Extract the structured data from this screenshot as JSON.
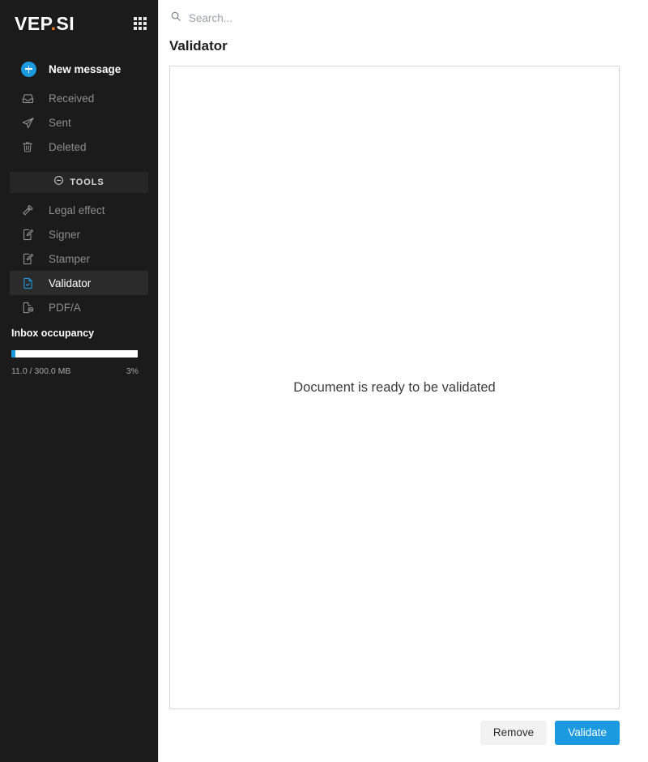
{
  "sidebar": {
    "brand": {
      "part1": "VEP",
      "dot": ".",
      "part2": "SI"
    },
    "apps_icon": "apps-grid-icon",
    "primary_action": {
      "label": "New message",
      "icon": "plus-circle-icon"
    },
    "nav_items": [
      {
        "label": "Received",
        "icon": "inbox-icon"
      },
      {
        "label": "Sent",
        "icon": "paper-plane-icon"
      },
      {
        "label": "Deleted",
        "icon": "trash-icon"
      }
    ],
    "tools_section": {
      "label": "TOOLS",
      "collapse_icon": "minus-circle-icon",
      "items": [
        {
          "label": "Legal effect",
          "icon": "gavel-icon",
          "active": false
        },
        {
          "label": "Signer",
          "icon": "document-pen-icon",
          "active": false
        },
        {
          "label": "Stamper",
          "icon": "document-pen-icon",
          "active": false
        },
        {
          "label": "Validator",
          "icon": "document-check-icon",
          "active": true
        },
        {
          "label": "PDF/A",
          "icon": "pdf-icon",
          "active": false
        }
      ]
    },
    "occupancy": {
      "title": "Inbox occupancy",
      "usage_text": "11.0 / 300.0 MB",
      "percent_text": "3%",
      "percent_value": 3
    }
  },
  "main": {
    "search": {
      "placeholder": "Search...",
      "value": "",
      "icon": "search-icon"
    },
    "page_title": "Validator",
    "document_panel": {
      "status_text": "Document is ready to be validated"
    },
    "buttons": {
      "remove": "Remove",
      "validate": "Validate"
    }
  },
  "colors": {
    "sidebar_bg": "#1b1b1b",
    "accent_blue": "#1b9ae0",
    "brand_dot_orange": "#f07c21",
    "active_row_bg": "#2b2b2b",
    "panel_border": "#d6d6d6"
  }
}
